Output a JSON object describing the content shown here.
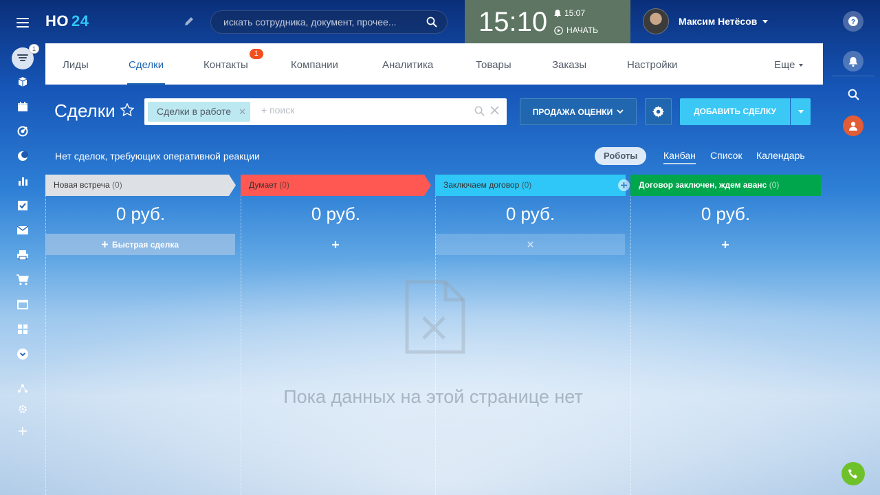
{
  "header": {
    "logo_main": "НО",
    "logo_num": "24",
    "search_placeholder": "искать сотрудника, документ, прочее...",
    "clock": "15:10",
    "alarm_time": "15:07",
    "start_label": "НАЧАТЬ",
    "clock_bg": "#5d7562",
    "user_name": "Максим Нетёсов"
  },
  "leftbar": {
    "badge": "1",
    "icons": [
      "feed-icon",
      "box-icon",
      "calendar-icon",
      "target-icon",
      "moon-icon",
      "chart-icon",
      "checkbox-icon",
      "mail-icon",
      "printer-icon",
      "cart-icon",
      "window-icon",
      "apps-icon",
      "chevron-down-icon",
      "network-icon",
      "gear-icon",
      "plus-icon"
    ]
  },
  "tabs": [
    {
      "label": "Лиды"
    },
    {
      "label": "Сделки"
    },
    {
      "label": "Контакты",
      "badge": "1"
    },
    {
      "label": "Компании"
    },
    {
      "label": "Аналитика"
    },
    {
      "label": "Товары"
    },
    {
      "label": "Заказы"
    },
    {
      "label": "Настройки"
    },
    {
      "label": "Еще"
    }
  ],
  "toolbar": {
    "title": "Сделки",
    "filter_chip": "Сделки в работе",
    "filter_placeholder": "+ поиск",
    "pipeline_label": "ПРОДАЖА ОЦЕНКИ",
    "add_label": "ДОБАВИТЬ СДЕЛКУ",
    "accent": "#2067b0",
    "add_color": "#3bc8f5"
  },
  "subbar": {
    "notice": "Нет сделок, требующих оперативной реакции",
    "robots": "Роботы",
    "views": [
      "Канбан",
      "Список",
      "Календарь"
    ]
  },
  "columns": [
    {
      "title": "Новая встреча",
      "count": "(0)",
      "sum": "0 руб.",
      "color": "#dde1e6",
      "quick": "Быстрая сделка"
    },
    {
      "title": "Думает",
      "count": "(0)",
      "sum": "0 руб.",
      "color": "#ff5752"
    },
    {
      "title": "Заключаем договор",
      "count": "(0)",
      "sum": "0 руб.",
      "color": "#2fc7f7"
    },
    {
      "title": "Договор заключен, ждем аванс",
      "count": "(0)",
      "sum": "0 руб.",
      "color": "#00a64c"
    }
  ],
  "empty": {
    "text": "Пока данных на этой странице нет"
  }
}
